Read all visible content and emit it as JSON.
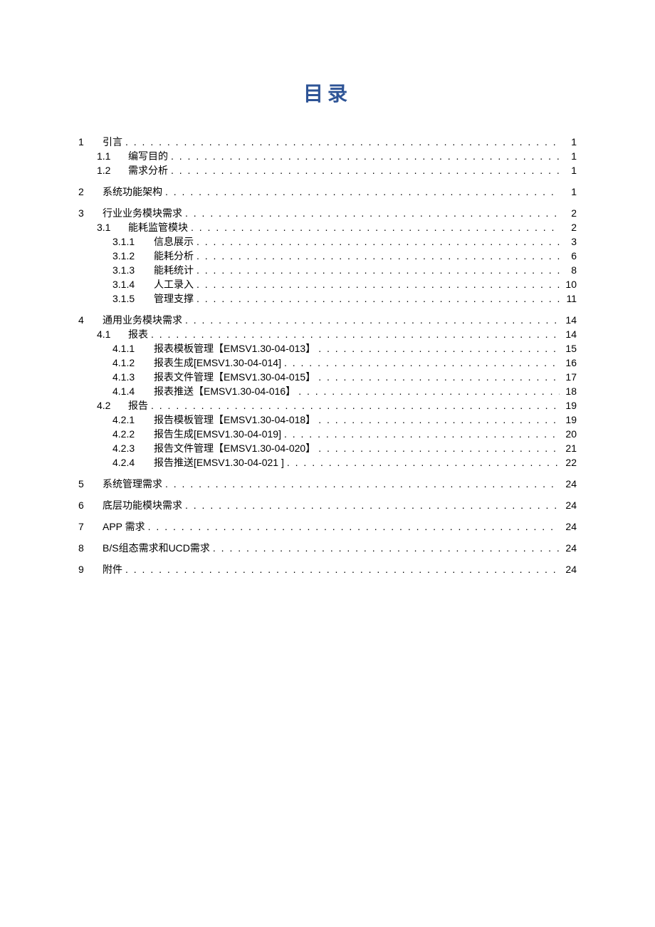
{
  "title": "目录",
  "toc": [
    {
      "level": 1,
      "num": "1",
      "label": "引言",
      "page": "1"
    },
    {
      "level": 2,
      "num": "1.1",
      "label": "编写目的",
      "page": "1"
    },
    {
      "level": 2,
      "num": "1.2",
      "label": "需求分析",
      "page": "1"
    },
    {
      "level": 1,
      "num": "2",
      "label": "系统功能架构",
      "page": "1"
    },
    {
      "level": 1,
      "num": "3",
      "label": "行业业务模块需求",
      "page": "2"
    },
    {
      "level": 2,
      "num": "3.1",
      "label": "能耗监管模块",
      "page": "2"
    },
    {
      "level": 3,
      "num": "3.1.1",
      "label": "信息展示",
      "page": "3"
    },
    {
      "level": 3,
      "num": "3.1.2",
      "label": "能耗分析",
      "page": "6"
    },
    {
      "level": 3,
      "num": "3.1.3",
      "label": "能耗统计",
      "page": "8"
    },
    {
      "level": 3,
      "num": "3.1.4",
      "label": "人工录入",
      "page": "10"
    },
    {
      "level": 3,
      "num": "3.1.5",
      "label": "管理支撑",
      "page": "11"
    },
    {
      "level": 1,
      "num": "4",
      "label": "通用业务模块需求",
      "page": "14"
    },
    {
      "level": 2,
      "num": "4.1",
      "label": "报表",
      "page": "14"
    },
    {
      "level": 3,
      "num": "4.1.1",
      "label": "报表模板管理【EMSV1.30-04-013】",
      "page": "15"
    },
    {
      "level": 3,
      "num": "4.1.2",
      "label": "报表生成[EMSV1.30-04-014]",
      "page": "16"
    },
    {
      "level": 3,
      "num": "4.1.3",
      "label": "报表文件管理【EMSV1.30-04-015】",
      "page": "17"
    },
    {
      "level": 3,
      "num": "4.1.4",
      "label": "报表推送【EMSV1.30-04-016】",
      "page": "18"
    },
    {
      "level": 2,
      "num": "4.2",
      "label": "报告",
      "page": "19"
    },
    {
      "level": 3,
      "num": "4.2.1",
      "label": "报告模板管理【EMSV1.30-04-018】",
      "page": "19"
    },
    {
      "level": 3,
      "num": "4.2.2",
      "label": "报告生成[EMSV1.30-04-019]",
      "page": "20"
    },
    {
      "level": 3,
      "num": "4.2.3",
      "label": "报告文件管理【EMSV1.30-04-020】",
      "page": "21"
    },
    {
      "level": 3,
      "num": "4.2.4",
      "label": "报告推送[EMSV1.30-04-021 ]",
      "page": "22"
    },
    {
      "level": 1,
      "num": "5",
      "label": "系统管理需求",
      "page": "24"
    },
    {
      "level": 1,
      "num": "6",
      "label": "底层功能模块需求",
      "page": "24"
    },
    {
      "level": 1,
      "num": "7",
      "label": "APP 需求",
      "page": "24"
    },
    {
      "level": 1,
      "num": "8",
      "label": "B/S组态需求和UCD需求",
      "page": "24"
    },
    {
      "level": 1,
      "num": "9",
      "label": "附件",
      "page": "24"
    }
  ]
}
